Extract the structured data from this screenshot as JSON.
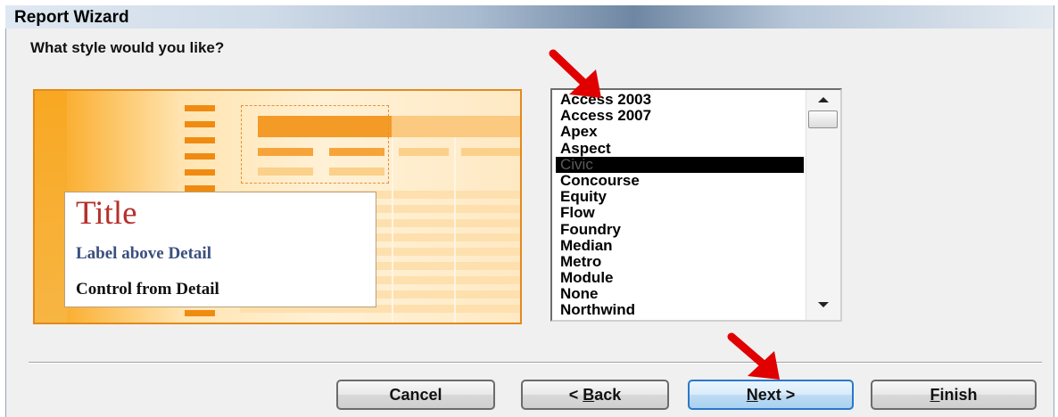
{
  "window": {
    "title": "Report Wizard"
  },
  "prompt": "What style would you like?",
  "preview": {
    "title": "Title",
    "label_text": "Label above Detail",
    "control_text": "Control from Detail"
  },
  "style_list": {
    "items": [
      "Access 2003",
      "Access 2007",
      "Apex",
      "Aspect",
      "Civic",
      "Concourse",
      "Equity",
      "Flow",
      "Foundry",
      "Median",
      "Metro",
      "Module",
      "None",
      "Northwind"
    ],
    "selected": "Civic"
  },
  "buttons": {
    "cancel": "Cancel",
    "back_prefix": "< ",
    "back_key": "B",
    "back_rest": "ack",
    "next_key": "N",
    "next_rest": "ext >",
    "finish_key": "F",
    "finish_rest": "inish"
  },
  "colors": {
    "annotation_arrow": "#e00000",
    "focus_border": "#2b78c8",
    "preview_accent": "#f39a27"
  }
}
